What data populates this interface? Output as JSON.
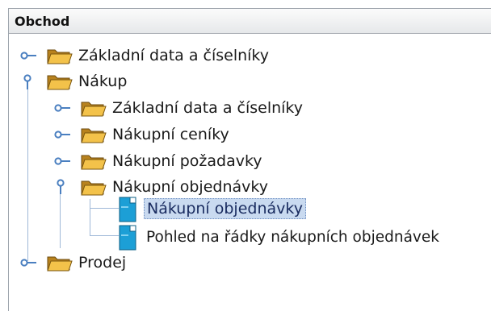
{
  "panel": {
    "title": "Obchod"
  },
  "tree": {
    "n1": "Základní data a číselníky",
    "n2": "Nákup",
    "n2_1": "Základní data a číselníky",
    "n2_2": "Nákupní ceníky",
    "n2_3": "Nákupní požadavky",
    "n2_4": "Nákupní objednávky",
    "n2_4_1": "Nákupní objednávky",
    "n2_4_2": "Pohled na řádky nákupních objednávek",
    "n3": "Prodej"
  },
  "colors": {
    "selection": "#c9daf0",
    "folder": "#e7b43a",
    "document": "#1c9fd6",
    "tree_line": "#9fb8d8"
  },
  "icons": {
    "collapsed_handle": "key-handle-collapsed-icon",
    "expanded_handle": "key-handle-expanded-icon",
    "folder": "open-folder-icon",
    "document": "document-icon"
  }
}
